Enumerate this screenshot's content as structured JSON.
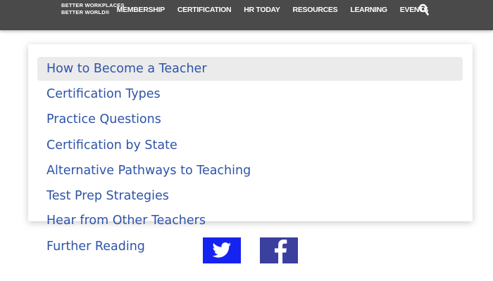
{
  "header": {
    "brand_line1": "BETTER WORKPLACES",
    "brand_line2": "BETTER WORLD®",
    "nav": [
      "MEMBERSHIP",
      "CERTIFICATION",
      "HR TODAY",
      "RESOURCES",
      "LEARNING",
      "EVENTS"
    ],
    "search_icon": "search-icon"
  },
  "menu": {
    "items": [
      "How to Become a Teacher",
      "Certification Types",
      "Practice Questions",
      "Certification by State",
      "Alternative Pathways to Teaching",
      "Test Prep Strategies",
      "Hear from Other Teachers"
    ],
    "active_index": 0
  },
  "page": {
    "further_reading": "Further Reading"
  },
  "social": {
    "twitter_icon": "twitter-icon",
    "facebook_icon": "facebook-icon"
  },
  "colors": {
    "header_bg": "#4a4a4a",
    "link": "#2f53a8",
    "active_bg": "#ebebeb",
    "twitter": "#1523f0",
    "facebook": "#3b3f9e"
  }
}
